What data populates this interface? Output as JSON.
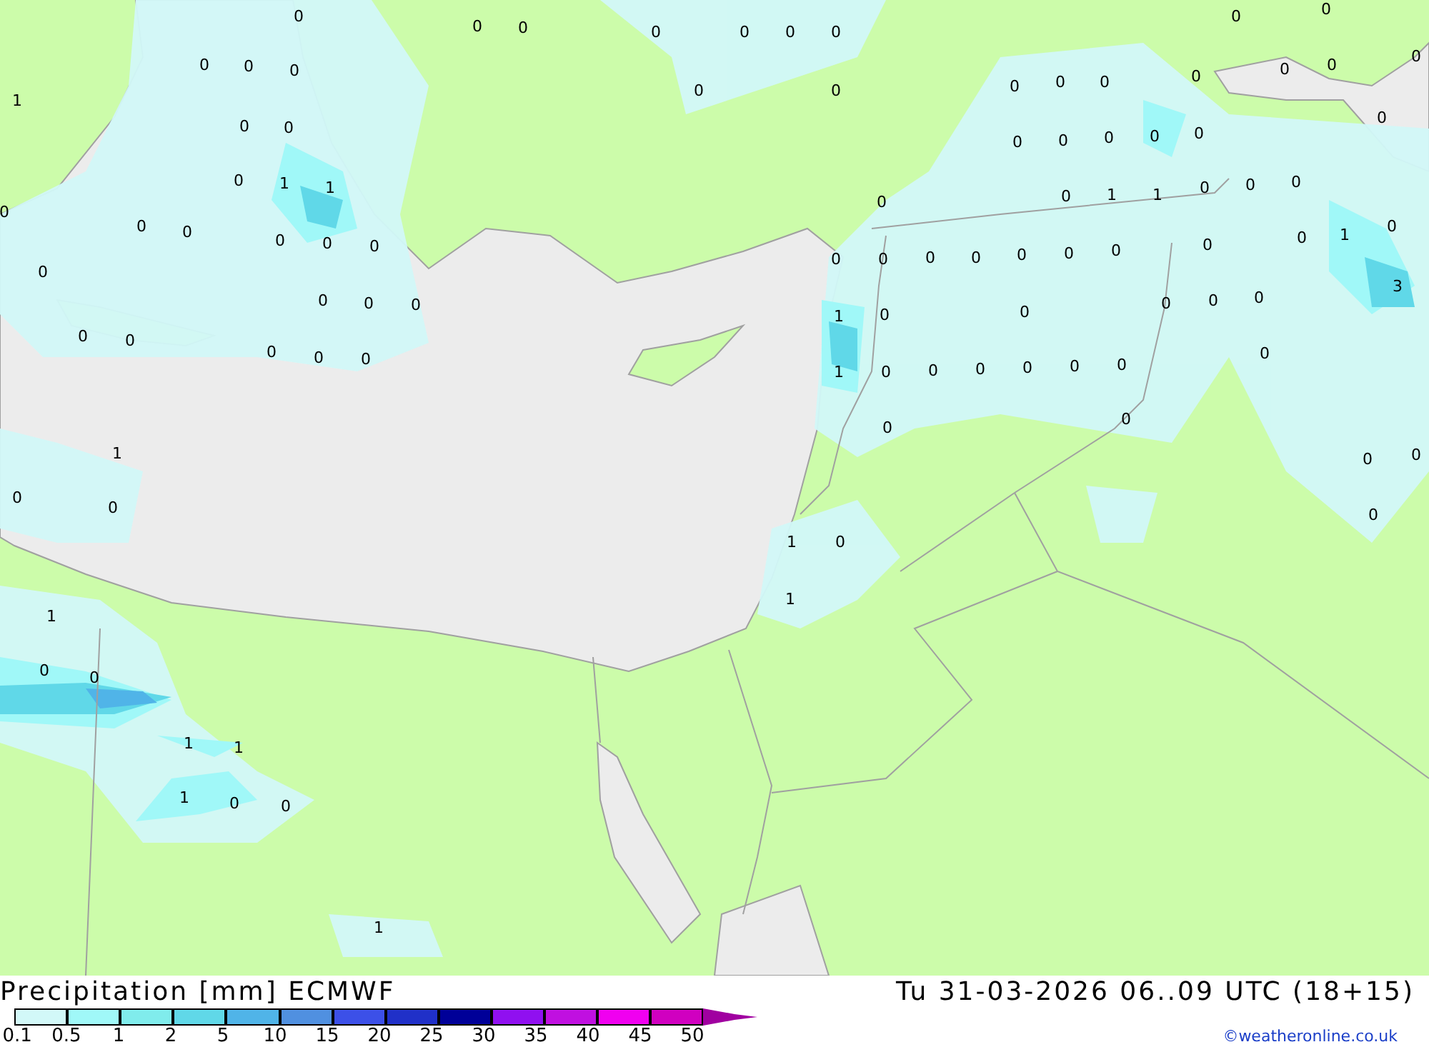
{
  "map": {
    "values": [
      "0",
      "0",
      "0",
      "0",
      "0",
      "0",
      "0",
      "0",
      "0",
      "1",
      "0",
      "0",
      "0",
      "0",
      "0",
      "0",
      "0",
      "0",
      "0",
      "0",
      "0",
      "0",
      "0",
      "0",
      "0",
      "0",
      "1",
      "1",
      "0",
      "0",
      "0",
      "0",
      "0",
      "0",
      "0",
      "0",
      "0",
      "0",
      "0",
      "0",
      "0",
      "1",
      "1",
      "0",
      "0",
      "0",
      "0",
      "1",
      "0",
      "0",
      "0",
      "0",
      "0",
      "0",
      "0",
      "0",
      "0",
      "0",
      "0",
      "0",
      "0",
      "0",
      "0",
      "0",
      "0",
      "0",
      "1",
      "0",
      "0",
      "0",
      "0",
      "0",
      "3",
      "0",
      "1",
      "0",
      "0",
      "0",
      "0",
      "0",
      "0",
      "0",
      "0",
      "1",
      "0",
      "0",
      "0",
      "0",
      "0",
      "1",
      "0",
      "1",
      "1",
      "0",
      "0",
      "1",
      "1",
      "1",
      "0",
      "0",
      "1"
    ]
  },
  "footer": {
    "title": "Precipitation [mm] ECMWF",
    "datetime": "Tu 31-03-2026 06..09 UTC (18+15)",
    "credit": "©weatheronline.co.uk"
  },
  "scale": {
    "labels": [
      "0.1",
      "0.5",
      "1",
      "2",
      "5",
      "10",
      "15",
      "20",
      "25",
      "30",
      "35",
      "40",
      "45",
      "50"
    ],
    "swatches": [
      {
        "color": "#d2f8f8"
      },
      {
        "color": "#a0f8f8"
      },
      {
        "color": "#80ecec"
      },
      {
        "color": "#60d8e8"
      },
      {
        "color": "#50b4e8"
      },
      {
        "color": "#5090e0"
      },
      {
        "color": "#3c50e8"
      },
      {
        "color": "#2030c8"
      },
      {
        "color": "#000098"
      },
      {
        "color": "#9010f0"
      },
      {
        "color": "#c010e0"
      },
      {
        "color": "#f000f0"
      },
      {
        "color": "#d000c0"
      }
    ]
  }
}
